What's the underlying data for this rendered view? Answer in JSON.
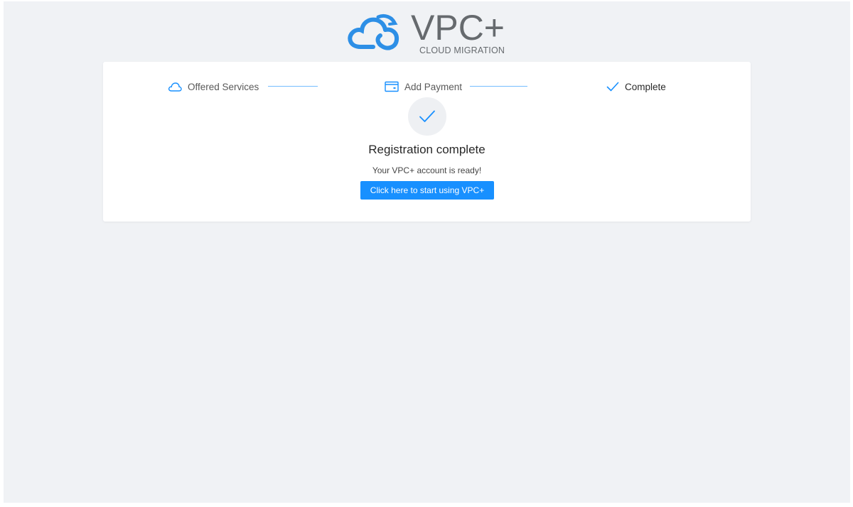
{
  "logo": {
    "name": "VPC+",
    "tagline": "CLOUD MIGRATION",
    "icon": "cloud-logo-icon"
  },
  "steps": [
    {
      "label": "Offered Services",
      "icon": "cloud-icon"
    },
    {
      "label": "Add Payment",
      "icon": "credit-card-icon"
    },
    {
      "label": "Complete",
      "icon": "check-icon"
    }
  ],
  "result": {
    "icon": "check-icon",
    "title": "Registration complete",
    "subtitle": "Your VPC+ account is ready!",
    "button_label": "Click here to start using VPC+"
  },
  "colors": {
    "primary": "#1890ff",
    "background": "#f0f2f5",
    "logo_blue": "#2d8fe6",
    "logo_gray": "#666a6e"
  }
}
